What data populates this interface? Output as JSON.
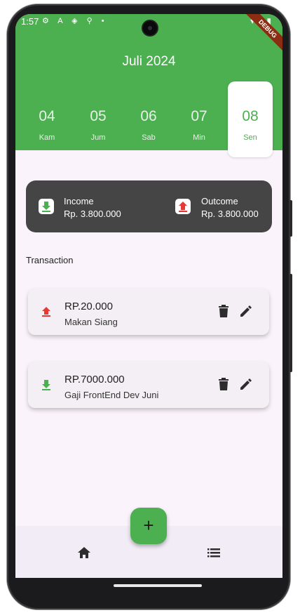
{
  "status_bar": {
    "time": "1:57",
    "left_icons": "⚙ A ◈ ⚲ •",
    "right_icons": "▾◢▮"
  },
  "debug_banner": "DEBUG",
  "header": {
    "month_title": "Juli 2024",
    "dates": [
      {
        "num": "04",
        "day": "Kam",
        "selected": false
      },
      {
        "num": "05",
        "day": "Jum",
        "selected": false
      },
      {
        "num": "06",
        "day": "Sab",
        "selected": false
      },
      {
        "num": "07",
        "day": "Min",
        "selected": false
      },
      {
        "num": "08",
        "day": "Sen",
        "selected": true
      }
    ]
  },
  "summary": {
    "income_label": "Income",
    "income_value": "Rp. 3.800.000",
    "outcome_label": "Outcome",
    "outcome_value": "Rp. 3.800.000"
  },
  "transactions_title": "Transaction",
  "transactions": [
    {
      "amount": "RP.20.000",
      "description": "Makan Siang",
      "type": "outcome"
    },
    {
      "amount": "RP.7000.000",
      "description": "Gaji FrontEnd Dev Juni",
      "type": "income"
    }
  ],
  "fab_label": "+",
  "nav": {
    "home_icon": "home-icon",
    "list_icon": "list-icon"
  },
  "colors": {
    "primary": "#4caf50",
    "summary_bg": "#454545",
    "income": "#4caf50",
    "outcome": "#e53935",
    "background": "#fbf3fb"
  }
}
